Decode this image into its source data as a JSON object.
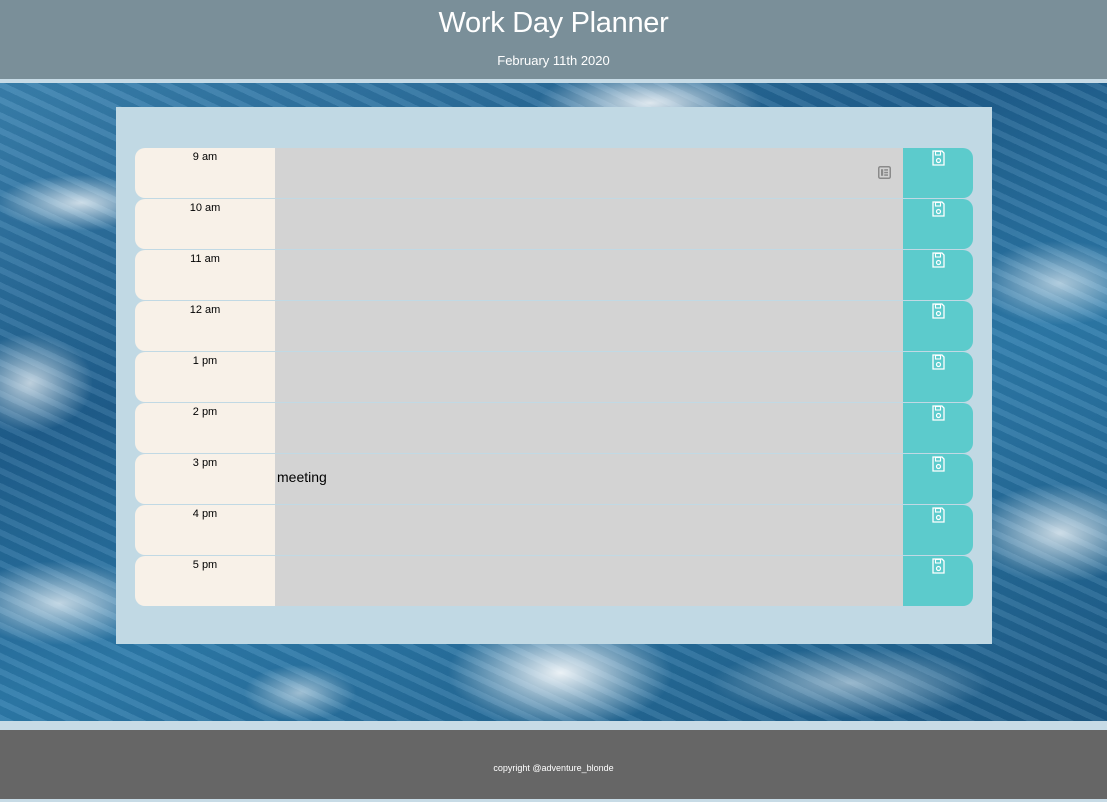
{
  "header": {
    "title": "Work Day Planner",
    "date": "February 11th 2020"
  },
  "planner": {
    "rows": [
      {
        "hour": "9 am",
        "text": ""
      },
      {
        "hour": "10 am",
        "text": ""
      },
      {
        "hour": "11 am",
        "text": ""
      },
      {
        "hour": "12 am",
        "text": ""
      },
      {
        "hour": "1 pm",
        "text": ""
      },
      {
        "hour": "2 pm",
        "text": ""
      },
      {
        "hour": "3 pm",
        "text": "meeting"
      },
      {
        "hour": "4 pm",
        "text": ""
      },
      {
        "hour": "5 pm",
        "text": ""
      }
    ],
    "save_icon": "save-floppy-icon"
  },
  "footer": {
    "copyright": "copyright @adventure_blonde"
  },
  "colors": {
    "header_bg": "#7a8f99",
    "hour_bg": "#f8f1e8",
    "textarea_bg": "#d3d3d3",
    "save_bg": "#5ccbcc",
    "container_bg": "#c1d9e4",
    "footer_bg": "#666666"
  }
}
